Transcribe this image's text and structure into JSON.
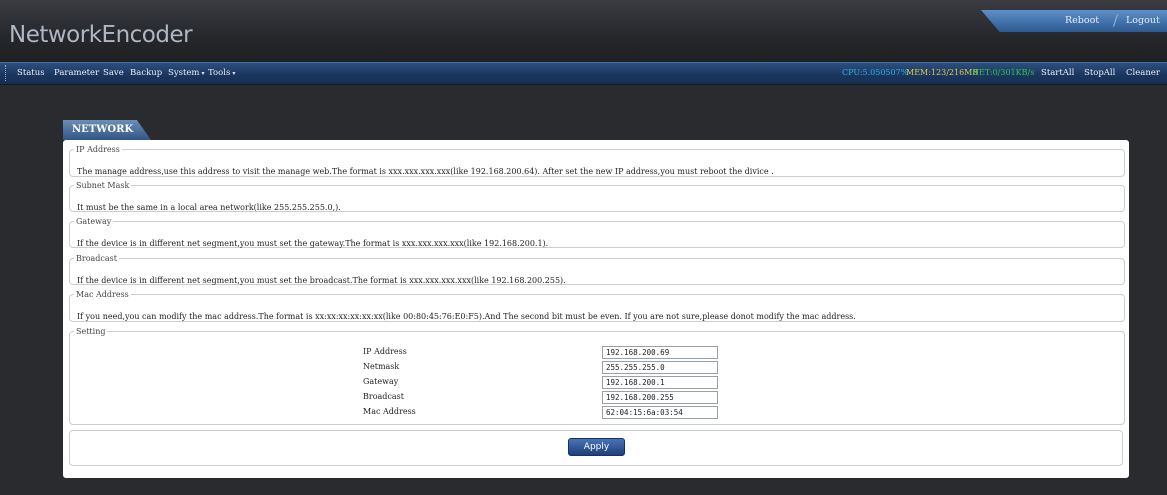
{
  "app": {
    "title": "NetworkEncoder"
  },
  "top_links": {
    "reboot": "Reboot",
    "logout": "Logout"
  },
  "menu": {
    "items": [
      "Status",
      "Parameter",
      "Save",
      "Backup",
      "System",
      "Tools"
    ],
    "dropdown_marker": "▾"
  },
  "stats": {
    "cpu": "CPU:5.050507%",
    "mem": "MEM:123/216MB",
    "net": "NET:0/301KB/s",
    "cpu_color": "#2bb0e0",
    "mem_color": "#e3c84b",
    "net_color": "#33c24a"
  },
  "actions": [
    "StartAll",
    "StopAll",
    "Cleaner"
  ],
  "page": {
    "tab": "NETWORK"
  },
  "sections": [
    {
      "title": "IP Address",
      "text": "The manage address,use this address to visit the manage web.The format is xxx.xxx.xxx.xxx(like 192.168.200.64). After set the new IP address,you must reboot the divice ."
    },
    {
      "title": "Subnet Mask",
      "text": "It must be the same in a local area network(like 255.255.255.0,)."
    },
    {
      "title": "Gateway",
      "text": "If the device is in different net segment,you must set the gateway.The format is xxx.xxx.xxx.xxx(like 192.168.200.1)."
    },
    {
      "title": "Broadcast",
      "text": "If the device is in different net segment,you must set the broadcast.The format is xxx.xxx.xxx.xxx(like 192.168.200.255)."
    },
    {
      "title": "Mac Address",
      "text": "If you need,you can modify the mac address.The format is xx:xx:xx:xx:xx:xx(like 00:80:45:76:E0:F5).And The second bit must be even. If you are not sure,please donot modify the mac address."
    }
  ],
  "setting": {
    "title": "Setting",
    "fields": [
      {
        "label": "IP Address",
        "value": "192.168.200.69"
      },
      {
        "label": "Netmask",
        "value": "255.255.255.0"
      },
      {
        "label": "Gateway",
        "value": "192.168.200.1"
      },
      {
        "label": "Broadcast",
        "value": "192.168.200.255"
      },
      {
        "label": "Mac Address",
        "value": "62:04:15:6a:03:54"
      }
    ]
  },
  "apply_label": "Apply"
}
